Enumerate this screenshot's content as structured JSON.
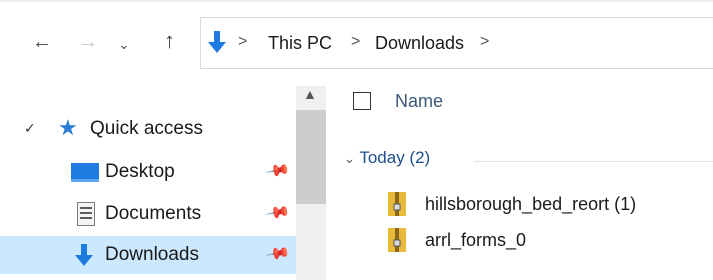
{
  "nav": {
    "back_icon": "arrow-left-icon",
    "forward_icon": "arrow-right-icon",
    "recent_icon": "chevron-down-icon",
    "up_icon": "arrow-up-icon"
  },
  "address": {
    "location_icon": "download-arrow-icon",
    "crumbs": [
      "This PC",
      "Downloads"
    ],
    "separator": ">"
  },
  "sidebar": {
    "quick_access": {
      "label": "Quick access",
      "expand_icon": "chevron-down-icon",
      "icon": "star-icon"
    },
    "items": [
      {
        "label": "Desktop",
        "icon": "desktop-icon",
        "pinned": true,
        "selected": false
      },
      {
        "label": "Documents",
        "icon": "documents-icon",
        "pinned": true,
        "selected": false
      },
      {
        "label": "Downloads",
        "icon": "download-arrow-icon",
        "pinned": true,
        "selected": true
      }
    ]
  },
  "content": {
    "column_name": "Name",
    "group": {
      "label": "Today (2)",
      "collapse_icon": "chevron-down-icon"
    },
    "files": [
      {
        "name": "hillsborough_bed_reort (1)",
        "icon": "zip-folder-icon"
      },
      {
        "name": "arrl_forms_0",
        "icon": "zip-folder-icon"
      }
    ]
  },
  "colors": {
    "accent_blue": "#1e7be0",
    "selected_bg": "#cce8ff",
    "star_blue": "#2b7cd3",
    "zip_yellow": "#e8b93a"
  }
}
